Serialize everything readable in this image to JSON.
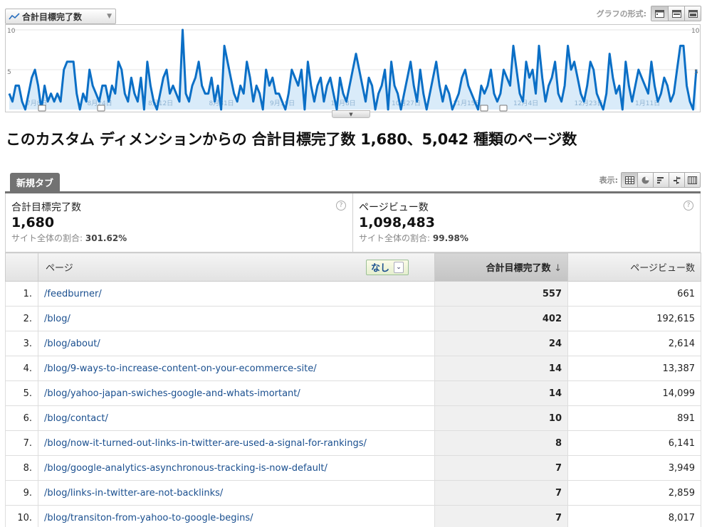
{
  "graph": {
    "metric_label": "合計目標完了数",
    "graph_mode_label": "グラフの形式:",
    "y_top_left": "10",
    "y_mid_left": "5",
    "y_top_right": "10",
    "y_mid_right": "5",
    "x_labels": [
      "7月8日",
      "8月24日",
      "8月12日",
      "8月31日",
      "9月19日",
      "10月8日",
      "10月27日",
      "11月15日",
      "12月4日",
      "12月23日",
      "1月11日"
    ],
    "colors": {
      "line": "#0b6fc6",
      "fill": "#d9ebf9"
    }
  },
  "chart_data": {
    "type": "area",
    "title": "",
    "xlabel": "",
    "ylabel": "",
    "ylim": [
      0,
      10
    ],
    "grid": true,
    "x_tick_labels": [
      "7月8日",
      "8月24日",
      "8月12日",
      "8月31日",
      "9月19日",
      "10月8日",
      "10月27日",
      "11月15日",
      "12月4日",
      "12月23日",
      "1月11日"
    ],
    "values": [
      2,
      1,
      3,
      3,
      1,
      0,
      2,
      4,
      5,
      3,
      0,
      3,
      1,
      2,
      1,
      2,
      1,
      5,
      6,
      6,
      6,
      2,
      0,
      2,
      1,
      5,
      3,
      2,
      1,
      3,
      3,
      1,
      3,
      2,
      6,
      5,
      2,
      1,
      4,
      2,
      1,
      4,
      0,
      6,
      3,
      1,
      0,
      2,
      4,
      5,
      2,
      3,
      2,
      1,
      10,
      2,
      1,
      3,
      4,
      6,
      3,
      2,
      2,
      4,
      1,
      3,
      0,
      8,
      6,
      4,
      2,
      1,
      3,
      2,
      6,
      4,
      1,
      3,
      2,
      0,
      5,
      3,
      4,
      2,
      2,
      1,
      0,
      2,
      5,
      4,
      3,
      5,
      0,
      6,
      3,
      1,
      3,
      4,
      1,
      3,
      4,
      2,
      0,
      4,
      2,
      1,
      3,
      5,
      7,
      5,
      3,
      1,
      4,
      3,
      0,
      2,
      3,
      5,
      0,
      6,
      3,
      2,
      0,
      2,
      4,
      6,
      3,
      1,
      5,
      2,
      0,
      2,
      4,
      6,
      3,
      1,
      3,
      2,
      0,
      1,
      2,
      4,
      5,
      3,
      2,
      1,
      0,
      3,
      2,
      3,
      5,
      2,
      1,
      2,
      5,
      4,
      3,
      8,
      5,
      2,
      1,
      6,
      4,
      5,
      2,
      8,
      4,
      1,
      3,
      4,
      6,
      2,
      1,
      3,
      8,
      5,
      6,
      4,
      2,
      1,
      3,
      6,
      5,
      2,
      1,
      0,
      2,
      7,
      4,
      2,
      3,
      0,
      6,
      3,
      1,
      3,
      5,
      4,
      3,
      2,
      6,
      3,
      1,
      2,
      4,
      3,
      1,
      2,
      5,
      8,
      8,
      3,
      1,
      0,
      5
    ]
  },
  "headline": "このカスタム ディメンションからの 合計目標完了数 1,680、5,042 種類のページ数",
  "tab": {
    "label": "新規タブ"
  },
  "view_label": "表示:",
  "summary": [
    {
      "title": "合計目標完了数",
      "value": "1,680",
      "pct_label": "サイト全体の割合:",
      "pct_value": "301.62%"
    },
    {
      "title": "ページビュー数",
      "value": "1,098,483",
      "pct_label": "サイト全体の割合:",
      "pct_value": "99.98%"
    }
  ],
  "help_glyph": "?",
  "table": {
    "col_page": "ページ",
    "secondary_dimension": "なし",
    "col_goal": "合計目標完了数",
    "sort_arrow": "↓",
    "col_pv": "ページビュー数",
    "rows": [
      {
        "idx": "1.",
        "page": "/feedburner/",
        "goal": "557",
        "pv": "661"
      },
      {
        "idx": "2.",
        "page": "/blog/",
        "goal": "402",
        "pv": "192,615"
      },
      {
        "idx": "3.",
        "page": "/blog/about/",
        "goal": "24",
        "pv": "2,614"
      },
      {
        "idx": "4.",
        "page": "/blog/9-ways-to-increase-content-on-your-ecommerce-site/",
        "goal": "14",
        "pv": "13,387"
      },
      {
        "idx": "5.",
        "page": "/blog/yahoo-japan-swiches-google-and-whats-imortant/",
        "goal": "14",
        "pv": "14,099"
      },
      {
        "idx": "6.",
        "page": "/blog/contact/",
        "goal": "10",
        "pv": "891"
      },
      {
        "idx": "7.",
        "page": "/blog/now-it-turned-out-links-in-twitter-are-used-a-signal-for-rankings/",
        "goal": "8",
        "pv": "6,141"
      },
      {
        "idx": "8.",
        "page": "/blog/google-analytics-asynchronous-tracking-is-now-default/",
        "goal": "7",
        "pv": "3,949"
      },
      {
        "idx": "9.",
        "page": "/blog/links-in-twitter-are-not-backlinks/",
        "goal": "7",
        "pv": "2,859"
      },
      {
        "idx": "10.",
        "page": "/blog/transiton-from-yahoo-to-google-begins/",
        "goal": "7",
        "pv": "8,017"
      }
    ]
  }
}
